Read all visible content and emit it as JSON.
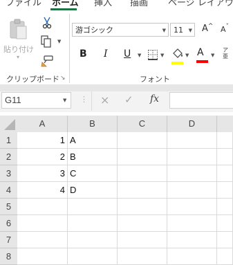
{
  "ribbon": {
    "tabs": [
      {
        "label": "ファイル"
      },
      {
        "label": "ホーム"
      },
      {
        "label": "挿入"
      },
      {
        "label": "描画"
      },
      {
        "label": "ページ レイアウト"
      }
    ],
    "accent_color": "#217346",
    "clipboard": {
      "paste_label": "貼り付け",
      "group_label": "クリップボード"
    },
    "font": {
      "font_name": "游ゴシック",
      "font_size": "11",
      "group_label": "フォント",
      "grow_label": "A",
      "shrink_label": "A",
      "bold_label": "B",
      "italic_label": "I",
      "underline_label": "U",
      "font_color_label": "A",
      "phonetic_label": "ア亜",
      "highlight_color": "#ffff00",
      "font_color": "#ff0000"
    }
  },
  "formula_bar": {
    "name_box": "G11",
    "cancel_icon": "×",
    "enter_icon": "✓",
    "fx_label": "fx",
    "content": ""
  },
  "sheet": {
    "columns": [
      "A",
      "B",
      "C",
      "D"
    ],
    "rows": [
      "1",
      "2",
      "3",
      "4",
      "5",
      "6",
      "7",
      "8"
    ],
    "cells": {
      "A1": "1",
      "B1": "A",
      "A2": "2",
      "B2": "B",
      "A3": "3",
      "B3": "C",
      "A4": "4",
      "B4": "D"
    }
  }
}
